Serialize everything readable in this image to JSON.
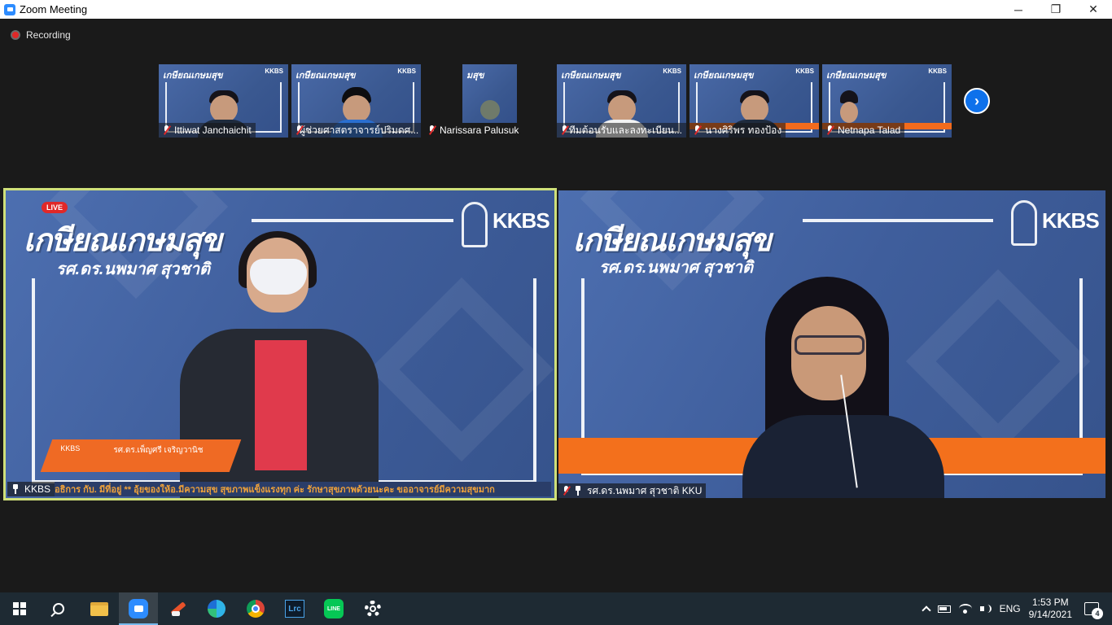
{
  "window": {
    "title": "Zoom Meeting",
    "minimize": "─",
    "restore": "❐",
    "close": "✕"
  },
  "recording": {
    "label": "Recording"
  },
  "thumbnails": [
    {
      "name": "Ittiwat Janchaichit",
      "headline": "เกษียณเกษมสุข"
    },
    {
      "name": "ผู้ช่วยศาสตราจารย์ปริมดศ...",
      "headline": "เกษียณเกษมสุข"
    },
    {
      "name": "Narissara Palusuk",
      "headline": "มสุข"
    },
    {
      "name": "ทีมต้อนรับและลงทะเบียน...",
      "headline": "เกษียณเกษมสุข"
    },
    {
      "name": "นางศิริพร ทองป้อง",
      "headline": "เกษียณเกษมสุข"
    },
    {
      "name": "Netnapa Talad",
      "headline": "เกษียณเกษมสุข"
    }
  ],
  "next_page_icon": "chevron-right-icon",
  "main_tiles": {
    "left": {
      "name": "KKBS",
      "headline": "เกษียณเกษมสุข",
      "subhead": "รศ.ดร.นพมาศ สุวชาติ",
      "logo": "KKBS",
      "live": "LIVE",
      "lower_third_small": "KKBS",
      "lower_third_name": "รศ.ดร.เพ็ญศรี เจริญวานิช",
      "ticker": "อธิการ กับ. มีที่อยู่ ** อุ้ยของให้อ.มีความสุข สุขภาพแข็งแรงทุก ค่ะ รักษาสุขภาพด้วยนะคะ ขออาจารย์มีความสุขมาก"
    },
    "right": {
      "name": "รศ.ดร.นพมาศ สุวชาติ KKU",
      "headline": "เกษียณเกษมสุข",
      "subhead": "รศ.ดร.นพมาศ สุวชาติ",
      "logo": "KKBS"
    }
  },
  "taskbar": {
    "apps": [
      "start",
      "search",
      "file-explorer",
      "zoom",
      "tool",
      "edge",
      "chrome",
      "lightroom-classic",
      "line",
      "settings"
    ],
    "lrc_label": "Lrc",
    "line_label": "LINE",
    "language": "ENG",
    "time": "1:53 PM",
    "date": "9/14/2021",
    "notifications": "4"
  },
  "colors": {
    "accent": "#2d8cff",
    "active_speaker_border": "#cfe07a",
    "stage_orange": "#f3701c",
    "stage_blue": "#3e5b96"
  }
}
